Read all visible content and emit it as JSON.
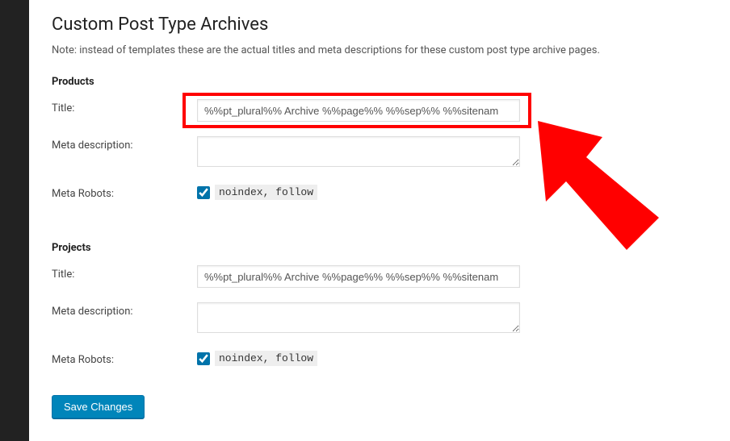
{
  "page": {
    "title": "Custom Post Type Archives",
    "note": "Note: instead of templates these are the actual titles and meta descriptions for these custom post type archive pages."
  },
  "sections": {
    "products": {
      "heading": "Products",
      "title_label": "Title:",
      "title_value": "%%pt_plural%% Archive %%page%% %%sep%% %%sitenam",
      "meta_desc_label": "Meta description:",
      "meta_desc_value": "",
      "robots_label": "Meta Robots:",
      "robots_checked": true,
      "robots_text": "noindex, follow"
    },
    "projects": {
      "heading": "Projects",
      "title_label": "Title:",
      "title_value": "%%pt_plural%% Archive %%page%% %%sep%% %%sitenam",
      "meta_desc_label": "Meta description:",
      "meta_desc_value": "",
      "robots_label": "Meta Robots:",
      "robots_checked": true,
      "robots_text": "noindex, follow"
    }
  },
  "buttons": {
    "save": "Save Changes"
  },
  "annotation": {
    "color": "#ff0000"
  }
}
